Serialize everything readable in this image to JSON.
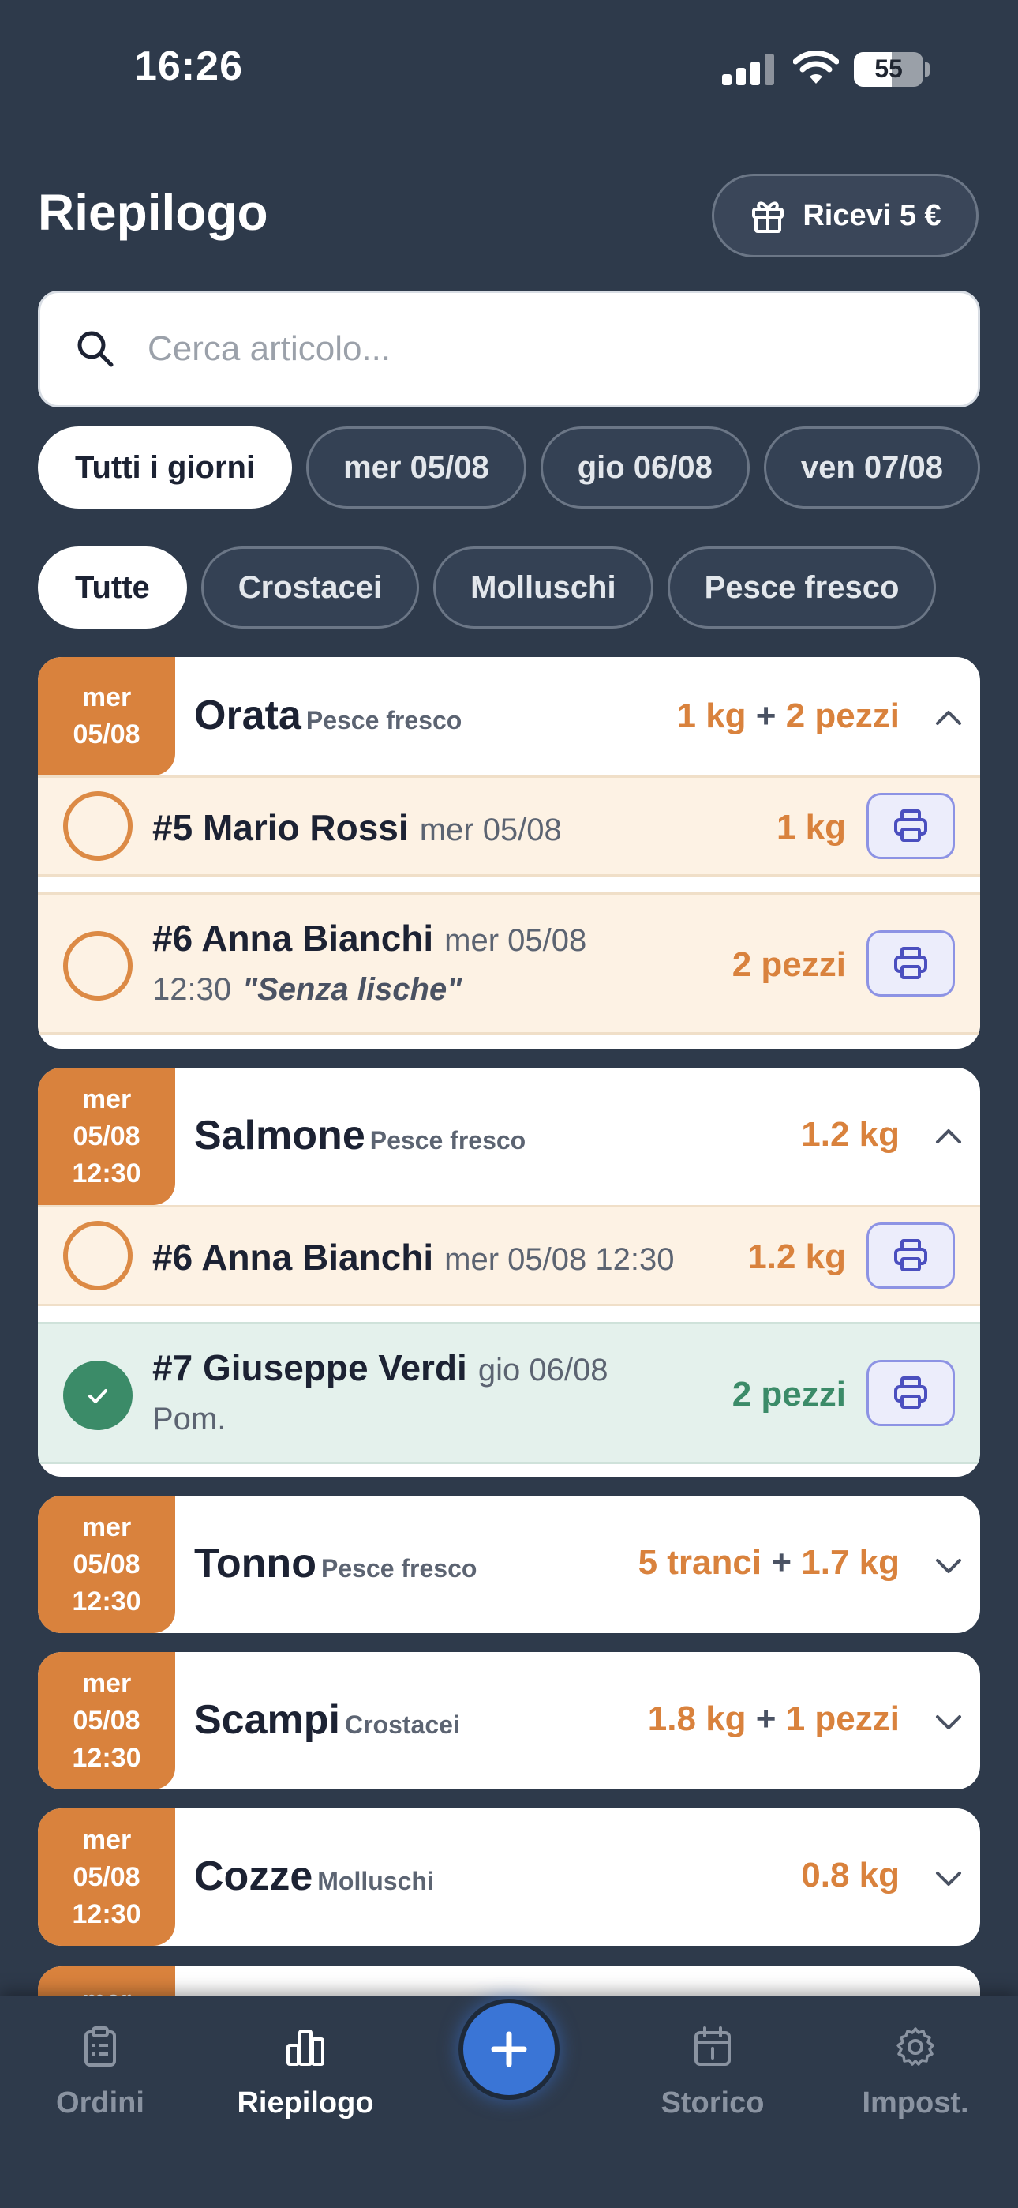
{
  "status": {
    "time": "16:26",
    "battery": "55"
  },
  "header": {
    "title": "Riepilogo",
    "reward_label": "Ricevi 5 €"
  },
  "search": {
    "placeholder": "Cerca articolo..."
  },
  "day_chips": [
    "Tutti i giorni",
    "mer 05/08",
    "gio 06/08",
    "ven 07/08"
  ],
  "category_chips": [
    "Tutte",
    "Crostacei",
    "Molluschi",
    "Pesce fresco"
  ],
  "products": [
    {
      "date_lines": [
        "mer",
        "05/08"
      ],
      "name": "Orata",
      "category": "Pesce fresco",
      "qty_a": "1 kg",
      "qty_sep": "+",
      "qty_b": "2 pezzi",
      "orders": [
        {
          "title": "#5 Mario Rossi",
          "date": "mer 05/08",
          "qty": "1 kg"
        },
        {
          "title": "#6 Anna Bianchi",
          "date": "mer 05/08",
          "time": "12:30",
          "note": "\"Senza lische\"",
          "qty": "2 pezzi"
        }
      ]
    },
    {
      "date_lines": [
        "mer",
        "05/08",
        "12:30"
      ],
      "name": "Salmone",
      "category": "Pesce fresco",
      "qty_a": "1.2 kg",
      "orders": [
        {
          "title": "#6 Anna Bianchi",
          "date": "mer 05/08 12:30",
          "qty": "1.2 kg"
        },
        {
          "title": "#7 Giuseppe Verdi",
          "date": "gio 06/08",
          "sub": "Pom.",
          "qty": "2 pezzi",
          "done": true
        }
      ]
    },
    {
      "date_lines": [
        "mer",
        "05/08",
        "12:30"
      ],
      "name": "Tonno",
      "category": "Pesce fresco",
      "qty_a": "5 tranci",
      "qty_sep": "+",
      "qty_b": "1.7 kg"
    },
    {
      "date_lines": [
        "mer",
        "05/08",
        "12:30"
      ],
      "name": "Scampi",
      "category": "Crostacei",
      "qty_a": "1.8 kg",
      "qty_sep": "+",
      "qty_b": "1 pezzi"
    },
    {
      "date_lines": [
        "mer",
        "05/08",
        "12:30"
      ],
      "name": "Cozze",
      "category": "Molluschi",
      "qty_a": "0.8 kg"
    },
    {
      "date_lines": [
        "mer"
      ]
    }
  ],
  "nav": {
    "orders": "Ordini",
    "summary": "Riepilogo",
    "history": "Storico",
    "settings": "Impost."
  },
  "colors": {
    "background": "#2e3a4b",
    "accent_orange": "#d9823d",
    "done_green": "#3b8b68",
    "fab_blue": "#3a75d6"
  }
}
